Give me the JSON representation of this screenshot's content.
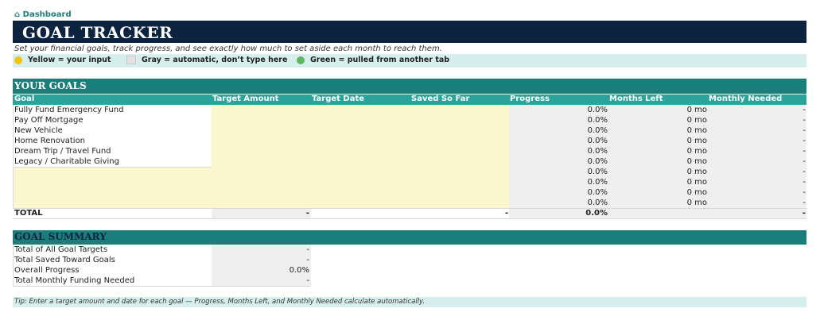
{
  "nav": {
    "home_label": "⌂ Dashboard"
  },
  "header": {
    "title": "GOAL TRACKER",
    "subtitle": "Set your financial goals, track progress, and see exactly how much to set aside each month to reach them."
  },
  "legend": {
    "yellow": "Yellow = your input",
    "gray": "Gray = automatic, don’t type here",
    "green": "Green = pulled from another tab"
  },
  "goals_section": {
    "title": "YOUR GOALS",
    "columns": [
      "Goal",
      "Target Amount",
      "Target Date",
      "Saved So Far",
      "Progress",
      "Months Left",
      "Monthly Needed"
    ],
    "goals": [
      "Fully Fund Emergency Fund",
      "Pay Off Mortgage",
      "New Vehicle",
      "Home Renovation",
      "Dream Trip / Travel Fund",
      "Legacy / Charitable Giving"
    ],
    "progress": [
      "0.0%",
      "0.0%",
      "0.0%",
      "0.0%",
      "0.0%",
      "0.0%",
      "0.0%",
      "0.0%",
      "0.0%",
      "0.0%"
    ],
    "months_left": [
      "0 mo",
      "0 mo",
      "0 mo",
      "0 mo",
      "0 mo",
      "0 mo",
      "0 mo",
      "0 mo",
      "0 mo",
      "0 mo"
    ],
    "monthly_needed": [
      "-",
      "-",
      "-",
      "-",
      "-",
      "-",
      "-",
      "-",
      "-",
      "-"
    ],
    "total": {
      "label": "TOTAL",
      "target_amount": "-",
      "saved": "-",
      "progress": "0.0%",
      "monthly_needed": "-"
    }
  },
  "summary_section": {
    "title": "GOAL SUMMARY",
    "rows": [
      {
        "label": "Total of All Goal Targets",
        "value": "-"
      },
      {
        "label": "Total Saved Toward Goals",
        "value": "-"
      },
      {
        "label": "Overall Progress",
        "value": "0.0%"
      },
      {
        "label": "Total Monthly Funding Needed",
        "value": "-"
      }
    ]
  },
  "tip": "Tip: Enter a target amount and date for each goal — Progress, Months Left, and Monthly Needed calculate automatically.",
  "colors": {
    "navy": "#0c2340",
    "teal": "#1a7f7a",
    "teal_light": "#2aa39a",
    "legend_bg": "#d6efed",
    "input_yellow": "#fdf7cf",
    "auto_gray": "#efefef"
  }
}
